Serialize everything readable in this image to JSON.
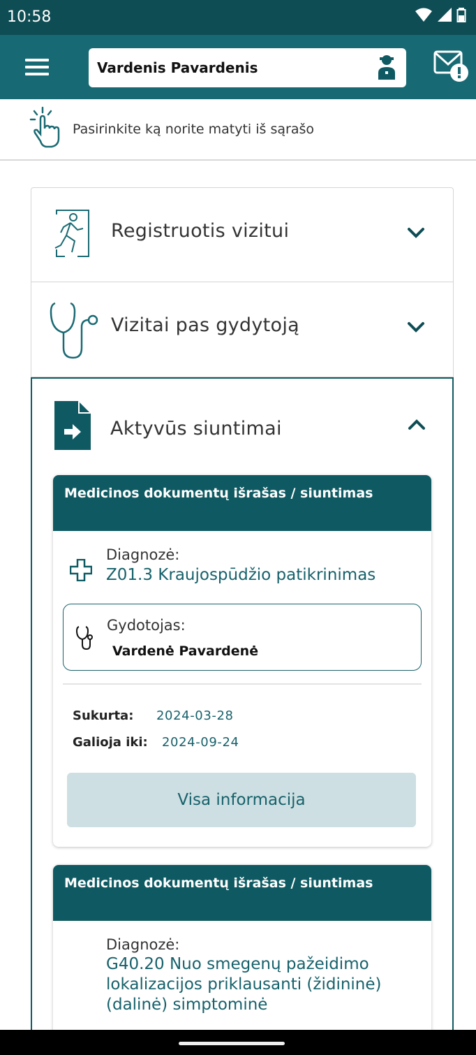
{
  "status_bar": {
    "time": "10:58"
  },
  "app_bar": {
    "patient_name": "Vardenis Pavardenis"
  },
  "hint": {
    "text": "Pasirinkite ką norite matyti iš sąrašo"
  },
  "accordion": [
    {
      "label": "Registruotis vizitui",
      "icon": "exit-door-icon",
      "expanded": false
    },
    {
      "label": "Vizitai pas gydytoją",
      "icon": "stethoscope-icon",
      "expanded": false
    },
    {
      "label": "Aktyvūs siuntimai",
      "icon": "document-arrow-icon",
      "expanded": true
    }
  ],
  "referrals": [
    {
      "title": "Medicinos dokumentų išrašas / siuntimas",
      "diagnosis_label": "Diagnozė:",
      "diagnosis": "Z01.3 Kraujospūdžio patikrinimas",
      "doctor_label": "Gydotojas:",
      "doctor": "Vardenė Pavardenė",
      "created_label": "Sukurta:",
      "created": "2024-03-28",
      "valid_label": "Galioja iki:",
      "valid_until": "2024-09-24",
      "button": "Visa informacija"
    },
    {
      "title": "Medicinos dokumentų išrašas / siuntimas",
      "diagnosis_label": "Diagnozė:",
      "diagnosis": "G40.20 Nuo smegenų pažeidimo lokalizacijos priklausanti (židininė) (dalinė) simptominė"
    }
  ],
  "colors": {
    "primary": "#176a73",
    "primary_dark": "#0f4d55",
    "accent_text": "#17616b",
    "button_bg": "#cddfe2"
  }
}
